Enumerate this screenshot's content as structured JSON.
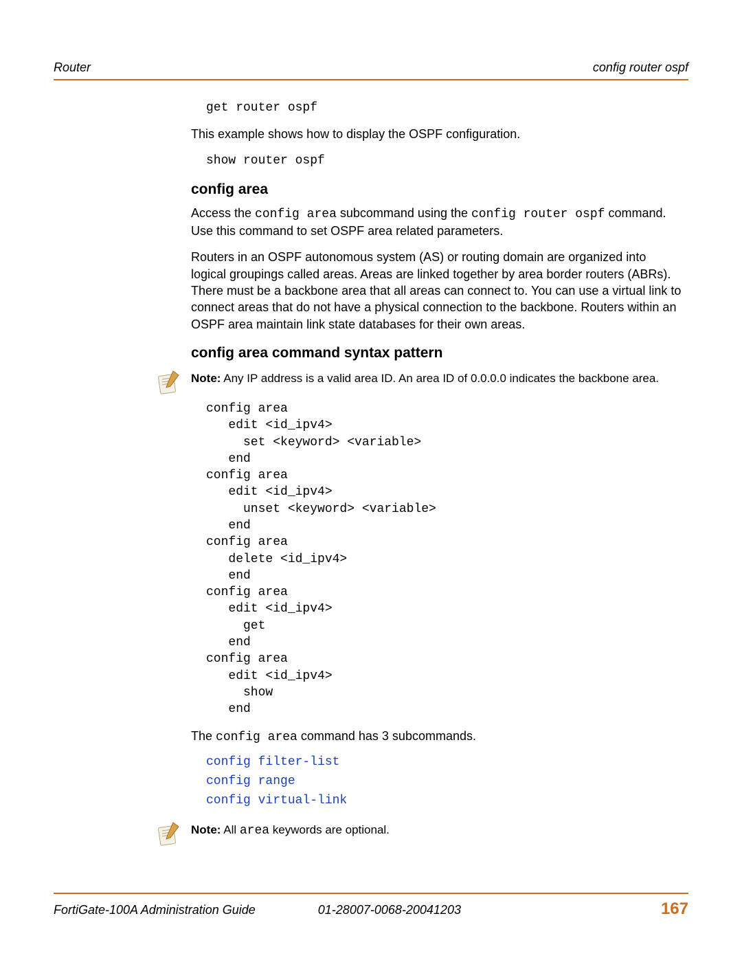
{
  "header": {
    "left": "Router",
    "right": "config router ospf"
  },
  "body": {
    "code1": "get router ospf",
    "para1": "This example shows how to display the OSPF configuration.",
    "code2": "show router ospf",
    "h_config_area": "config area",
    "para2_a": "Access the ",
    "para2_code1": "config area",
    "para2_b": " subcommand using the ",
    "para2_code2": "config router ospf",
    "para2_c": " command. Use this command to set OSPF area related parameters.",
    "para3": "Routers in an OSPF autonomous system (AS) or routing domain are organized into logical groupings called areas. Areas are linked together by area border routers (ABRs). There must be a backbone area that all areas can connect to. You can use a virtual link to connect areas that do not have a physical connection to the backbone. Routers within an OSPF area maintain link state databases for their own areas.",
    "h_syntax": "config area command syntax pattern",
    "note1_label": "Note:",
    "note1_text": " Any IP address is a valid area ID. An area ID of 0.0.0.0 indicates the backbone area.",
    "code_syntax": "config area\n   edit <id_ipv4>\n     set <keyword> <variable>\n   end\nconfig area\n   edit <id_ipv4>\n     unset <keyword> <variable>\n   end\nconfig area\n   delete <id_ipv4>\n   end\nconfig area\n   edit <id_ipv4>\n     get\n   end\nconfig area\n   edit <id_ipv4>\n     show\n   end",
    "para4_a": "The ",
    "para4_code": "config area",
    "para4_b": " command has 3 subcommands.",
    "link1": "config filter-list",
    "link2": "config range",
    "link3": "config virtual-link",
    "note2_label": "Note:",
    "note2_a": " All ",
    "note2_code": "area",
    "note2_b": " keywords are optional."
  },
  "footer": {
    "guide": "FortiGate-100A Administration Guide",
    "docnum": "01-28007-0068-20041203",
    "page": "167"
  }
}
